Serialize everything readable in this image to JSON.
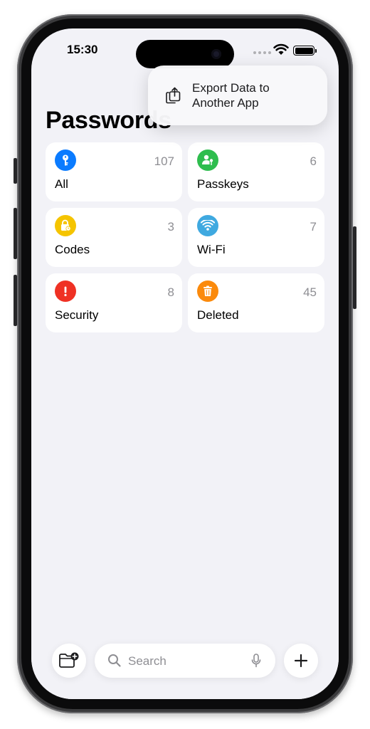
{
  "status_bar": {
    "time": "15:30"
  },
  "page": {
    "title": "Passwords"
  },
  "menu": {
    "export_label": "Export Data to Another App"
  },
  "categories": [
    {
      "label": "All",
      "count": "107",
      "icon": "key-icon",
      "color": "#0a7bff"
    },
    {
      "label": "Passkeys",
      "count": "6",
      "icon": "person-key-icon",
      "color": "#2ebd4e"
    },
    {
      "label": "Codes",
      "count": "3",
      "icon": "lock-clock-icon",
      "color": "#f5c400"
    },
    {
      "label": "Wi-Fi",
      "count": "7",
      "icon": "wifi-icon",
      "color": "#3fa9e0"
    },
    {
      "label": "Security",
      "count": "8",
      "icon": "exclamation-icon",
      "color": "#ef3124"
    },
    {
      "label": "Deleted",
      "count": "45",
      "icon": "trash-icon",
      "color": "#fb8a0c"
    }
  ],
  "toolbar": {
    "search_placeholder": "Search"
  }
}
